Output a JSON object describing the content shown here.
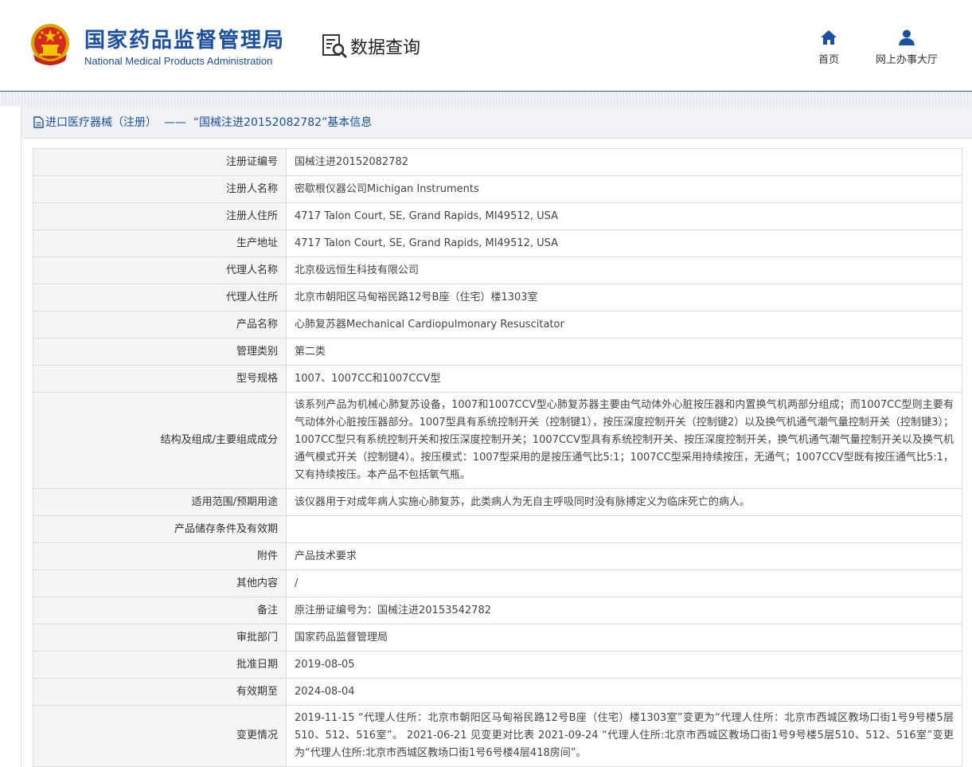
{
  "header": {
    "brand_cn": "国家药品监督管理局",
    "brand_en": "National Medical Products Administration",
    "query_label": "数据查询",
    "nav": [
      {
        "label": "首页",
        "icon": "home-icon"
      },
      {
        "label": "网上办事大厅",
        "icon": "user-icon"
      }
    ],
    "accent_color": "#1a4fa3"
  },
  "panel": {
    "title": "进口医疗器械（注册）  ——  “国械注进20152082782”基本信息"
  },
  "rows": [
    {
      "label": "注册证编号",
      "value": "国械注进20152082782"
    },
    {
      "label": "注册人名称",
      "value": "密歇根仪器公司Michigan Instruments"
    },
    {
      "label": "注册人住所",
      "value": "4717 Talon Court, SE, Grand Rapids, MI49512, USA"
    },
    {
      "label": "生产地址",
      "value": "4717 Talon Court, SE, Grand Rapids, MI49512, USA"
    },
    {
      "label": "代理人名称",
      "value": "北京极远恒生科技有限公司"
    },
    {
      "label": "代理人住所",
      "value": "北京市朝阳区马甸裕民路12号B座（住宅）楼1303室"
    },
    {
      "label": "产品名称",
      "value": "心肺复苏器Mechanical Cardiopulmonary Resuscitator"
    },
    {
      "label": "管理类别",
      "value": "第二类"
    },
    {
      "label": "型号规格",
      "value": "1007、1007CC和1007CCV型"
    },
    {
      "label": "结构及组成/主要组成成分",
      "value": "该系列产品为机械心肺复苏设备，1007和1007CCV型心肺复苏器主要由气动体外心脏按压器和内置换气机两部分组成；而1007CC型则主要有气动体外心脏按压器部分。1007型具有系统控制开关（控制键1），按压深度控制开关（控制键2）以及换气机通气潮气量控制开关（控制键3）；1007CC型只有系统控制开关和按压深度控制开关；1007CCV型具有系统控制开关、按压深度控制开关，换气机通气潮气量控制开关以及换气机通气模式开关（控制键4）。按压模式：1007型采用的是按压通气比5:1；1007CC型采用持续按压，无通气；1007CCV型既有按压通气比5:1，又有持续按压。本产品不包括氧气瓶。"
    },
    {
      "label": "适用范围/预期用途",
      "value": "该仪器用于对成年病人实施心肺复苏，此类病人为无自主呼吸同时没有脉搏定义为临床死亡的病人。"
    },
    {
      "label": "产品储存条件及有效期",
      "value": ""
    },
    {
      "label": "附件",
      "value": "产品技术要求"
    },
    {
      "label": "其他内容",
      "value": "/"
    },
    {
      "label": "备注",
      "value": "原注册证编号为：国械注进20153542782"
    },
    {
      "label": "审批部门",
      "value": "国家药品监督管理局"
    },
    {
      "label": "批准日期",
      "value": "2019-08-05"
    },
    {
      "label": "有效期至",
      "value": "2024-08-04"
    },
    {
      "label": "变更情况",
      "value": "2019-11-15 “代理人住所：北京市朝阳区马甸裕民路12号B座（住宅）楼1303室”变更为“代理人住所：北京市西城区教场口街1号9号楼5层510、512、516室”。 2021-06-21 见变更对比表 2021-09-24 “代理人住所:北京市西城区教场口街1号9号楼5层510、512、516室”变更为“代理人住所:北京市西城区教场口街1号6号楼4层418房间”。"
    }
  ]
}
